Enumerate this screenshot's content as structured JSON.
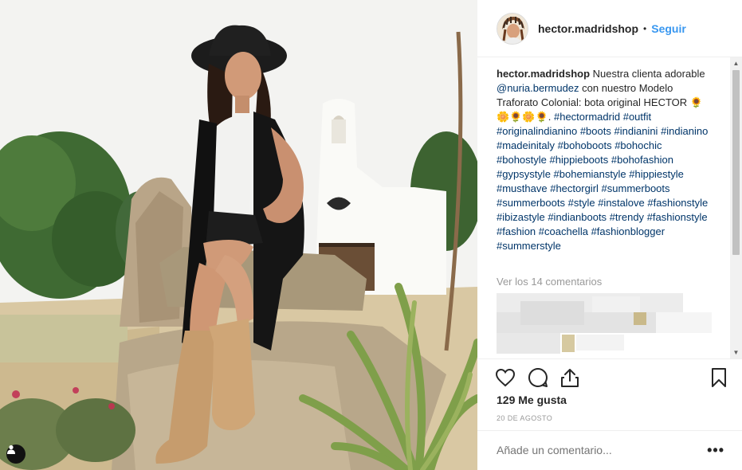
{
  "post": {
    "username": "hector.madridshop",
    "separator": "•",
    "follow_label": "Seguir",
    "caption": {
      "username": "hector.madridshop",
      "text_1": "Nuestra clienta adorable",
      "mention": "@nuria.bermudez",
      "text_2": "con nuestro Modelo Traforato Colonial: bota original HECTOR",
      "emojis": "🌻🌼🌻🌼🌻.",
      "hashtags": [
        "#hectormadrid",
        "#outfit",
        "#originalindianino",
        "#boots",
        "#indianini",
        "#indianino",
        "#madeinitaly",
        "#bohoboots",
        "#bohochic",
        "#bohostyle",
        "#hippieboots",
        "#bohofashion",
        "#gypsystyle",
        "#bohemianstyle",
        "#hippiestyle",
        "#musthave",
        "#hectorgirl",
        "#summerboots",
        "#summerboots",
        "#style",
        "#instalove",
        "#fashionstyle",
        "#ibizastyle",
        "#indianboots",
        "#trendy",
        "#fashionstyle",
        "#fashion",
        "#coachella",
        "#fashionblogger",
        "#summerstyle"
      ]
    },
    "view_comments": "Ver los 14 comentarios",
    "likes": "129 Me gusta",
    "date": "20 DE AGOSTO",
    "comment_placeholder": "Añade un comentario...",
    "more_label": "•••"
  },
  "icons": {
    "like": "heart-icon",
    "comment": "comment-bubble-icon",
    "share": "share-icon",
    "save": "bookmark-icon",
    "user_tag": "user-tag-icon"
  },
  "colors": {
    "link": "#003569",
    "follow": "#3897f0",
    "muted": "#999999",
    "text": "#262626"
  }
}
